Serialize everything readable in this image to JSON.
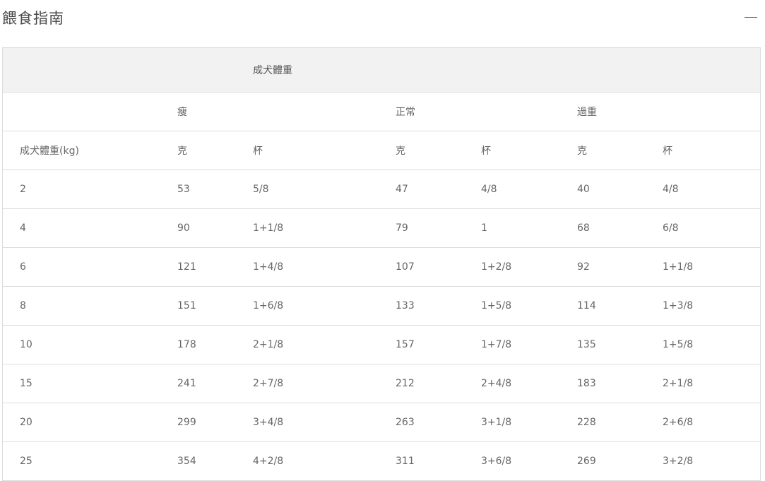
{
  "section": {
    "title": "餵食指南",
    "collapse_icon": "minus-icon"
  },
  "table": {
    "top_header": "成犬體重",
    "groups": [
      "瘦",
      "正常",
      "過重"
    ],
    "row_header_label": "成犬體重(kg)",
    "unit_labels": [
      "克",
      "杯",
      "克",
      "杯",
      "克",
      "杯"
    ],
    "rows": [
      [
        "2",
        "53",
        "5/8",
        "47",
        "4/8",
        "40",
        "4/8"
      ],
      [
        "4",
        "90",
        "1+1/8",
        "79",
        "1",
        "68",
        "6/8"
      ],
      [
        "6",
        "121",
        "1+4/8",
        "107",
        "1+2/8",
        "92",
        "1+1/8"
      ],
      [
        "8",
        "151",
        "1+6/8",
        "133",
        "1+5/8",
        "114",
        "1+3/8"
      ],
      [
        "10",
        "178",
        "2+1/8",
        "157",
        "1+7/8",
        "135",
        "1+5/8"
      ],
      [
        "15",
        "241",
        "2+7/8",
        "212",
        "2+4/8",
        "183",
        "2+1/8"
      ],
      [
        "20",
        "299",
        "3+4/8",
        "263",
        "3+1/8",
        "228",
        "2+6/8"
      ],
      [
        "25",
        "354",
        "4+2/8",
        "311",
        "3+6/8",
        "269",
        "3+2/8"
      ]
    ]
  }
}
